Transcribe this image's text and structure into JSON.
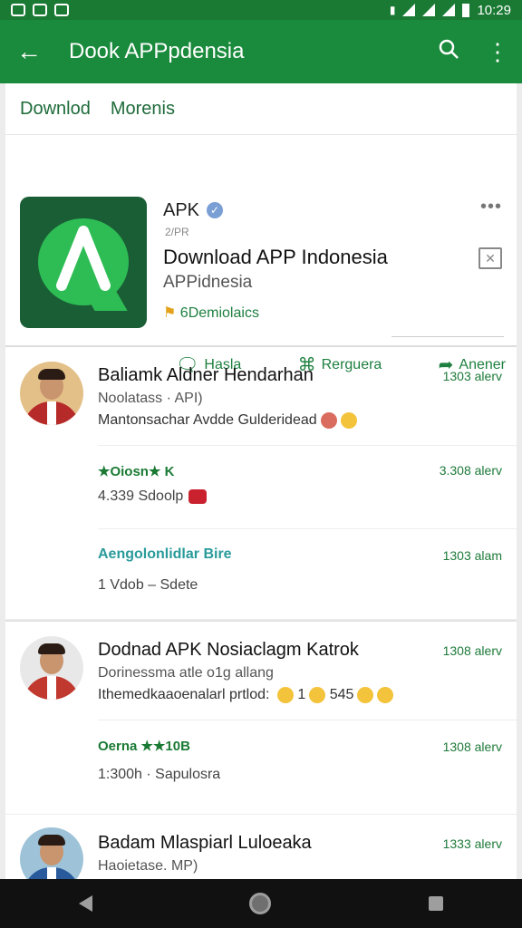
{
  "status_bar": {
    "time": "10:29"
  },
  "app_bar": {
    "title": "Dook APPpdensia"
  },
  "breadcrumb": [
    "Downlod",
    "Morenis"
  ],
  "app": {
    "badge": "APK",
    "small_label": "2/PR",
    "name": "Download APP Indonesia",
    "publisher": "APPidnesia",
    "downloads": "6Demiolaics",
    "actions": [
      {
        "label": "Hasla",
        "icon": "comment-icon"
      },
      {
        "label": "Rerguera",
        "icon": "bookmark-icon"
      },
      {
        "label": "Anener",
        "icon": "share-icon"
      }
    ]
  },
  "reviews": [
    {
      "name": "Baliamk Aldner Hendarhan",
      "meta": "Noolatass · API)",
      "text": "Mantonsachar Avdde Gulderidead",
      "time": "1303 alerv",
      "reply": {
        "rating": "★Oiosn★ K",
        "time": "3.308 alerv",
        "sub": "4.339 Sdoolp"
      },
      "link": {
        "label": "Aengolonlidlar Bire",
        "time": "1303 alam",
        "sub": "1 Vdob – Sdete"
      }
    },
    {
      "name": "Dodnad APK Nosiaclagm Katrok",
      "meta": "Dorinessma atle o1g allang",
      "text": "Ithemedkaaoenalarl prtlod: ",
      "text_count1": "1",
      "text_count2": "545",
      "time": "1308 alerv",
      "reply": {
        "rating": "Oerna ★★10B",
        "time": "1308 alerv",
        "sub": "1:300h · Sapulosra"
      }
    },
    {
      "name": "Badam Mlaspiarl Luloeaka",
      "meta": "Haoietase. MP)",
      "time": "1333 alerv"
    }
  ]
}
